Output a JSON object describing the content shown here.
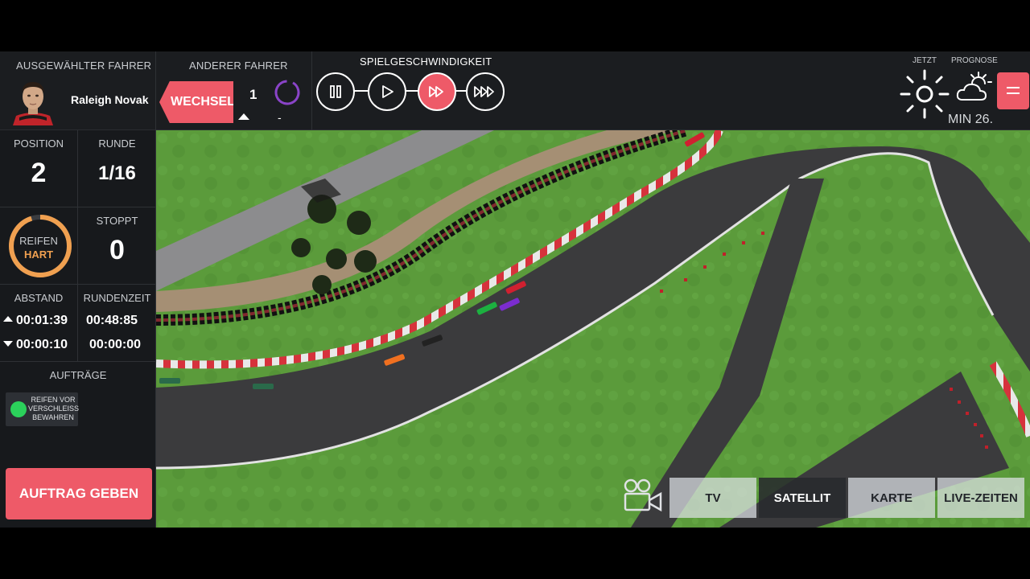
{
  "selected_driver": {
    "title": "AUSGEWÄHLTER FAHRER",
    "name": "Raleigh Novak"
  },
  "other_driver": {
    "title": "ANDERER FAHRER",
    "switch_label": "WECHSEL",
    "number": "1",
    "dash": "-"
  },
  "game_speed": {
    "title": "SPIELGESCHWINDIGKEIT",
    "buttons": [
      "pause-icon",
      "play-icon",
      "fast-forward-icon",
      "fastest-forward-icon"
    ],
    "active_index": 2
  },
  "weather": {
    "now_label": "JETZT",
    "forecast_label": "PROGNOSE",
    "now_icon": "sun-icon",
    "forecast_icon": "cloud-sun-icon",
    "minute_label": "MIN 26."
  },
  "stats": {
    "position_label": "POSITION",
    "position_value": "2",
    "lap_label": "RUNDE",
    "lap_value": "1/16",
    "tyre_label": "REIFEN",
    "tyre_value": "HART",
    "tyre_wear_fraction": 0.95,
    "stops_label": "STOPPT",
    "stops_value": "0",
    "gap_label": "ABSTAND",
    "gap_ahead": "00:01:39",
    "gap_behind": "00:00:10",
    "laptime_label": "RUNDENZEIT",
    "laptime_current": "00:48:85",
    "laptime_last": "00:00:00"
  },
  "orders": {
    "title": "AUFTRÄGE",
    "active_order": "REIFEN VOR VERSCHLEISS BEWAHREN",
    "give_order_label": "AUFTRAG GEBEN"
  },
  "views": {
    "camera_icon": "camera-icon",
    "buttons": [
      "TV",
      "SATELLIT",
      "KARTE",
      "LIVE-ZEITEN"
    ],
    "active_index": 1
  },
  "colors": {
    "accent": "#ee5a68",
    "tyre_hard": "#f0a050",
    "order_active": "#2bd15b",
    "grass": "#5a9a3a",
    "asphalt": "#3a3a3c"
  }
}
